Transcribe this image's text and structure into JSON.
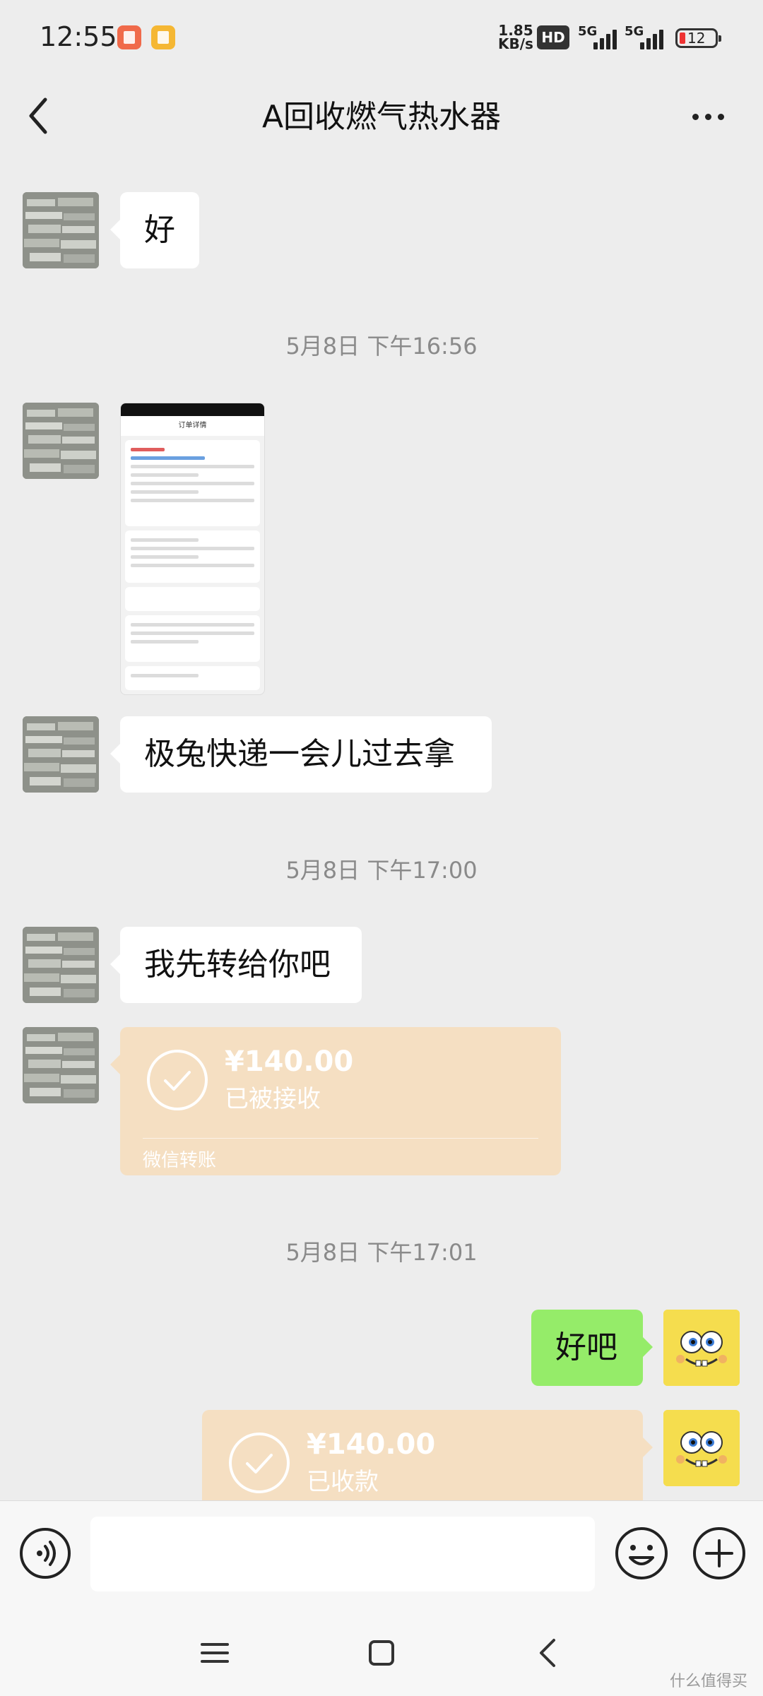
{
  "status_bar": {
    "time": "12:55",
    "net_speed_value": "1.85",
    "net_speed_unit": "KB/s",
    "hd_badge": "HD",
    "signal1_label": "5G",
    "signal2_label": "5G",
    "battery": "12"
  },
  "header": {
    "title": "A回收燃气热水器"
  },
  "messages": {
    "m1_text": "好",
    "ts1": "5月8日 下午16:56",
    "img_title": "订单详情",
    "m3_text": "极兔快递一会儿过去拿",
    "ts2": "5月8日 下午17:00",
    "m4_text": "我先转给你吧",
    "transfer1": {
      "amount": "¥140.00",
      "status": "已被接收",
      "source": "微信转账"
    },
    "ts3": "5月8日 下午17:01",
    "m6_text": "好吧",
    "transfer2": {
      "amount": "¥140.00",
      "status": "已收款"
    }
  },
  "input": {
    "value": "",
    "placeholder": ""
  },
  "watermark": "什么值得买",
  "colors": {
    "background": "#ededed",
    "self_bubble": "#95ec69",
    "transfer_card": "#f5dfc2",
    "other_bubble": "#ffffff"
  },
  "icons": [
    "back-arrow-icon",
    "more-icon",
    "voice-icon",
    "emoji-icon",
    "plus-icon",
    "check-icon",
    "menu-icon",
    "home-icon",
    "back-icon"
  ]
}
